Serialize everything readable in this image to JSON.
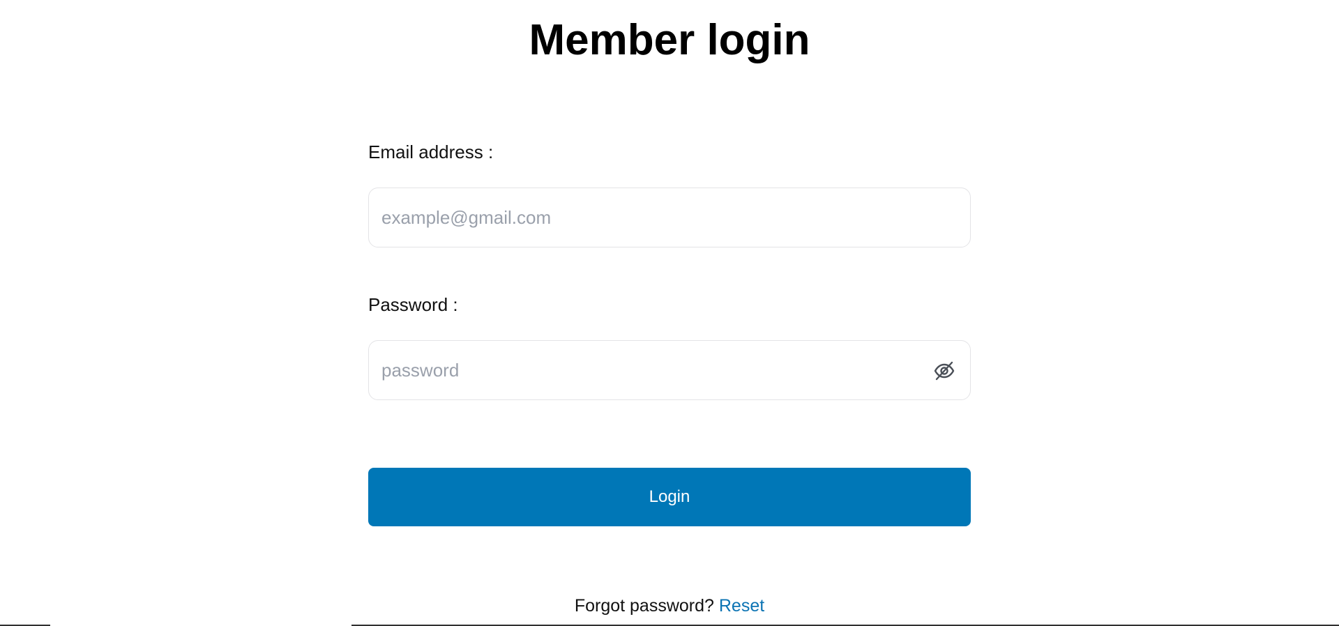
{
  "page": {
    "title": "Member login"
  },
  "form": {
    "email": {
      "label": "Email address :",
      "value": "",
      "placeholder": "example@gmail.com"
    },
    "password": {
      "label": "Password :",
      "value": "",
      "placeholder": "password",
      "toggle_icon": "eye-off-icon"
    },
    "login_button": "Login"
  },
  "footer": {
    "forgot_text": "Forgot password?",
    "reset_link": "Reset"
  },
  "colors": {
    "primary": "#0077b7",
    "link": "#0b73b3",
    "placeholder": "#9aa0ab",
    "border": "#e3e3e6"
  }
}
